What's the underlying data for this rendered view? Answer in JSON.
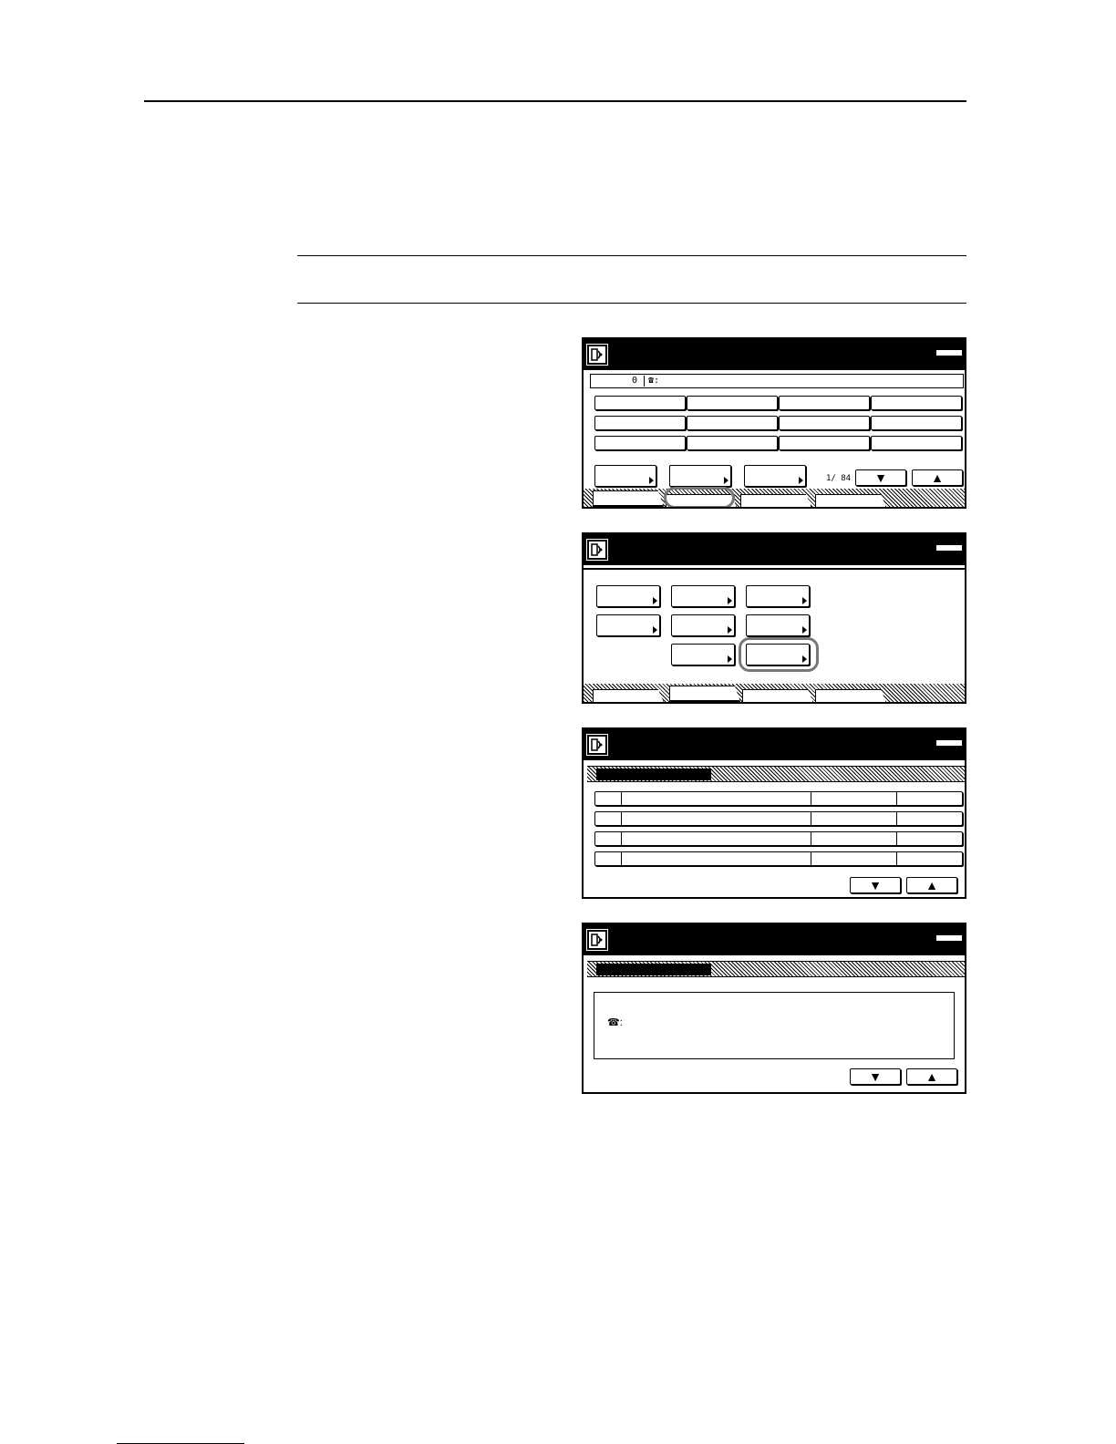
{
  "icons": {
    "fax_mode": "fax-icon",
    "arrow_down": "▼",
    "arrow_up": "▲",
    "phone": "☎"
  },
  "colors": {
    "titlebar": "#000000",
    "highlight": "#777777"
  },
  "screen1": {
    "dest_count": "0",
    "dest_phone_label": "☎:",
    "page_indicator": "1/ 84",
    "down_label": "▼",
    "up_label": "▲"
  },
  "screen3": {
    "down_label": "▼",
    "up_label": "▲"
  },
  "screen4": {
    "phone_label": "☎:",
    "down_label": "▼",
    "up_label": "▲"
  }
}
